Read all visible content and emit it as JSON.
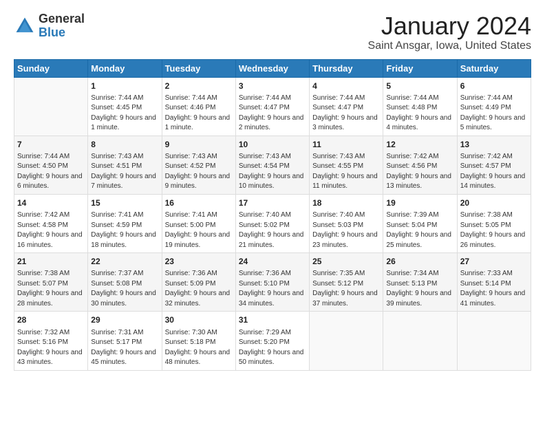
{
  "logo": {
    "general": "General",
    "blue": "Blue"
  },
  "title": "January 2024",
  "subtitle": "Saint Ansgar, Iowa, United States",
  "days": [
    "Sunday",
    "Monday",
    "Tuesday",
    "Wednesday",
    "Thursday",
    "Friday",
    "Saturday"
  ],
  "weeks": [
    [
      {
        "day": "",
        "sunrise": "",
        "sunset": "",
        "daylight": ""
      },
      {
        "day": "1",
        "sunrise": "Sunrise: 7:44 AM",
        "sunset": "Sunset: 4:45 PM",
        "daylight": "Daylight: 9 hours and 1 minute."
      },
      {
        "day": "2",
        "sunrise": "Sunrise: 7:44 AM",
        "sunset": "Sunset: 4:46 PM",
        "daylight": "Daylight: 9 hours and 1 minute."
      },
      {
        "day": "3",
        "sunrise": "Sunrise: 7:44 AM",
        "sunset": "Sunset: 4:47 PM",
        "daylight": "Daylight: 9 hours and 2 minutes."
      },
      {
        "day": "4",
        "sunrise": "Sunrise: 7:44 AM",
        "sunset": "Sunset: 4:47 PM",
        "daylight": "Daylight: 9 hours and 3 minutes."
      },
      {
        "day": "5",
        "sunrise": "Sunrise: 7:44 AM",
        "sunset": "Sunset: 4:48 PM",
        "daylight": "Daylight: 9 hours and 4 minutes."
      },
      {
        "day": "6",
        "sunrise": "Sunrise: 7:44 AM",
        "sunset": "Sunset: 4:49 PM",
        "daylight": "Daylight: 9 hours and 5 minutes."
      }
    ],
    [
      {
        "day": "7",
        "sunrise": "Sunrise: 7:44 AM",
        "sunset": "Sunset: 4:50 PM",
        "daylight": "Daylight: 9 hours and 6 minutes."
      },
      {
        "day": "8",
        "sunrise": "Sunrise: 7:43 AM",
        "sunset": "Sunset: 4:51 PM",
        "daylight": "Daylight: 9 hours and 7 minutes."
      },
      {
        "day": "9",
        "sunrise": "Sunrise: 7:43 AM",
        "sunset": "Sunset: 4:52 PM",
        "daylight": "Daylight: 9 hours and 9 minutes."
      },
      {
        "day": "10",
        "sunrise": "Sunrise: 7:43 AM",
        "sunset": "Sunset: 4:54 PM",
        "daylight": "Daylight: 9 hours and 10 minutes."
      },
      {
        "day": "11",
        "sunrise": "Sunrise: 7:43 AM",
        "sunset": "Sunset: 4:55 PM",
        "daylight": "Daylight: 9 hours and 11 minutes."
      },
      {
        "day": "12",
        "sunrise": "Sunrise: 7:42 AM",
        "sunset": "Sunset: 4:56 PM",
        "daylight": "Daylight: 9 hours and 13 minutes."
      },
      {
        "day": "13",
        "sunrise": "Sunrise: 7:42 AM",
        "sunset": "Sunset: 4:57 PM",
        "daylight": "Daylight: 9 hours and 14 minutes."
      }
    ],
    [
      {
        "day": "14",
        "sunrise": "Sunrise: 7:42 AM",
        "sunset": "Sunset: 4:58 PM",
        "daylight": "Daylight: 9 hours and 16 minutes."
      },
      {
        "day": "15",
        "sunrise": "Sunrise: 7:41 AM",
        "sunset": "Sunset: 4:59 PM",
        "daylight": "Daylight: 9 hours and 18 minutes."
      },
      {
        "day": "16",
        "sunrise": "Sunrise: 7:41 AM",
        "sunset": "Sunset: 5:00 PM",
        "daylight": "Daylight: 9 hours and 19 minutes."
      },
      {
        "day": "17",
        "sunrise": "Sunrise: 7:40 AM",
        "sunset": "Sunset: 5:02 PM",
        "daylight": "Daylight: 9 hours and 21 minutes."
      },
      {
        "day": "18",
        "sunrise": "Sunrise: 7:40 AM",
        "sunset": "Sunset: 5:03 PM",
        "daylight": "Daylight: 9 hours and 23 minutes."
      },
      {
        "day": "19",
        "sunrise": "Sunrise: 7:39 AM",
        "sunset": "Sunset: 5:04 PM",
        "daylight": "Daylight: 9 hours and 25 minutes."
      },
      {
        "day": "20",
        "sunrise": "Sunrise: 7:38 AM",
        "sunset": "Sunset: 5:05 PM",
        "daylight": "Daylight: 9 hours and 26 minutes."
      }
    ],
    [
      {
        "day": "21",
        "sunrise": "Sunrise: 7:38 AM",
        "sunset": "Sunset: 5:07 PM",
        "daylight": "Daylight: 9 hours and 28 minutes."
      },
      {
        "day": "22",
        "sunrise": "Sunrise: 7:37 AM",
        "sunset": "Sunset: 5:08 PM",
        "daylight": "Daylight: 9 hours and 30 minutes."
      },
      {
        "day": "23",
        "sunrise": "Sunrise: 7:36 AM",
        "sunset": "Sunset: 5:09 PM",
        "daylight": "Daylight: 9 hours and 32 minutes."
      },
      {
        "day": "24",
        "sunrise": "Sunrise: 7:36 AM",
        "sunset": "Sunset: 5:10 PM",
        "daylight": "Daylight: 9 hours and 34 minutes."
      },
      {
        "day": "25",
        "sunrise": "Sunrise: 7:35 AM",
        "sunset": "Sunset: 5:12 PM",
        "daylight": "Daylight: 9 hours and 37 minutes."
      },
      {
        "day": "26",
        "sunrise": "Sunrise: 7:34 AM",
        "sunset": "Sunset: 5:13 PM",
        "daylight": "Daylight: 9 hours and 39 minutes."
      },
      {
        "day": "27",
        "sunrise": "Sunrise: 7:33 AM",
        "sunset": "Sunset: 5:14 PM",
        "daylight": "Daylight: 9 hours and 41 minutes."
      }
    ],
    [
      {
        "day": "28",
        "sunrise": "Sunrise: 7:32 AM",
        "sunset": "Sunset: 5:16 PM",
        "daylight": "Daylight: 9 hours and 43 minutes."
      },
      {
        "day": "29",
        "sunrise": "Sunrise: 7:31 AM",
        "sunset": "Sunset: 5:17 PM",
        "daylight": "Daylight: 9 hours and 45 minutes."
      },
      {
        "day": "30",
        "sunrise": "Sunrise: 7:30 AM",
        "sunset": "Sunset: 5:18 PM",
        "daylight": "Daylight: 9 hours and 48 minutes."
      },
      {
        "day": "31",
        "sunrise": "Sunrise: 7:29 AM",
        "sunset": "Sunset: 5:20 PM",
        "daylight": "Daylight: 9 hours and 50 minutes."
      },
      {
        "day": "",
        "sunrise": "",
        "sunset": "",
        "daylight": ""
      },
      {
        "day": "",
        "sunrise": "",
        "sunset": "",
        "daylight": ""
      },
      {
        "day": "",
        "sunrise": "",
        "sunset": "",
        "daylight": ""
      }
    ]
  ]
}
